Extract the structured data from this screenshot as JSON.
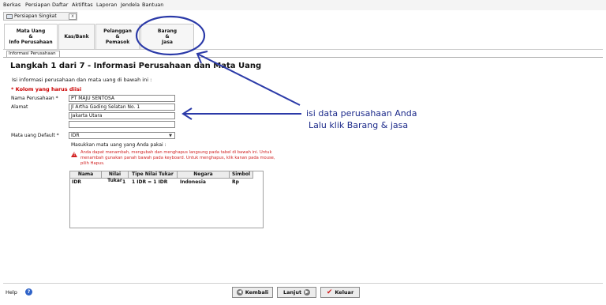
{
  "menu": [
    "Berkas",
    "Persiapan",
    "Daftar",
    "Aktifitas",
    "Laporan",
    "Jendela",
    "Bantuan"
  ],
  "quick_tab": {
    "label": "Persiapan Singkat",
    "close": "x"
  },
  "steps": [
    {
      "label": "Mata Uang\n&\nInfo Perusahaan"
    },
    {
      "label": "Kas/Bank"
    },
    {
      "label": "Pelanggan\n&\nPemasok"
    },
    {
      "label": "Barang\n&\nJasa"
    }
  ],
  "info_tab": "Informasi Perusahaan",
  "title": "Langkah 1 dari 7   - Informasi Perusahaan dan Mata Uang",
  "instruction": "Isi informasi perusahaan dan mata uang di bawah ini :",
  "required_note": "* Kolom yang harus diisi",
  "form": {
    "company_label": "Nama Perusahaan *",
    "company_value": "PT MAJU SENTOSA",
    "address_label": "Alamat",
    "address_lines": [
      "Jl Artha Gading Selatan No. 1",
      "Jakarta Utara",
      ""
    ],
    "extra_line": "",
    "currency_label": "Mata uang Default *",
    "currency_value": "IDR"
  },
  "hint": "Masukkan mata uang yang Anda pakai :",
  "warning": "Anda dapat menambah, mengubah dan menghapus langsung pada tabel di bawah ini. Untuk menambah gunakan panah bawah pada keyboard. Untuk menghapus, klik kanan pada mouse, pilih Hapus.",
  "currency_table": {
    "headers": [
      "Nama",
      "Nilai Tukar",
      "Tipe Nilai Tukar",
      "Negara",
      "Simbol"
    ],
    "rows": [
      [
        "IDR",
        "1",
        "1 IDR = 1 IDR",
        "Indonesia",
        "Rp"
      ]
    ]
  },
  "annotation": {
    "line1": "isi data perusahaan Anda",
    "line2": "Lalu klik Barang & jasa",
    "color": "#1c2a8a"
  },
  "footer": {
    "help": "Help",
    "back": "Kembali",
    "next": "Lanjut",
    "exit": "Keluar"
  },
  "icons": {
    "help": "help-icon",
    "back": "arrow-left-icon",
    "next": "arrow-right-icon",
    "exit": "check-icon"
  }
}
